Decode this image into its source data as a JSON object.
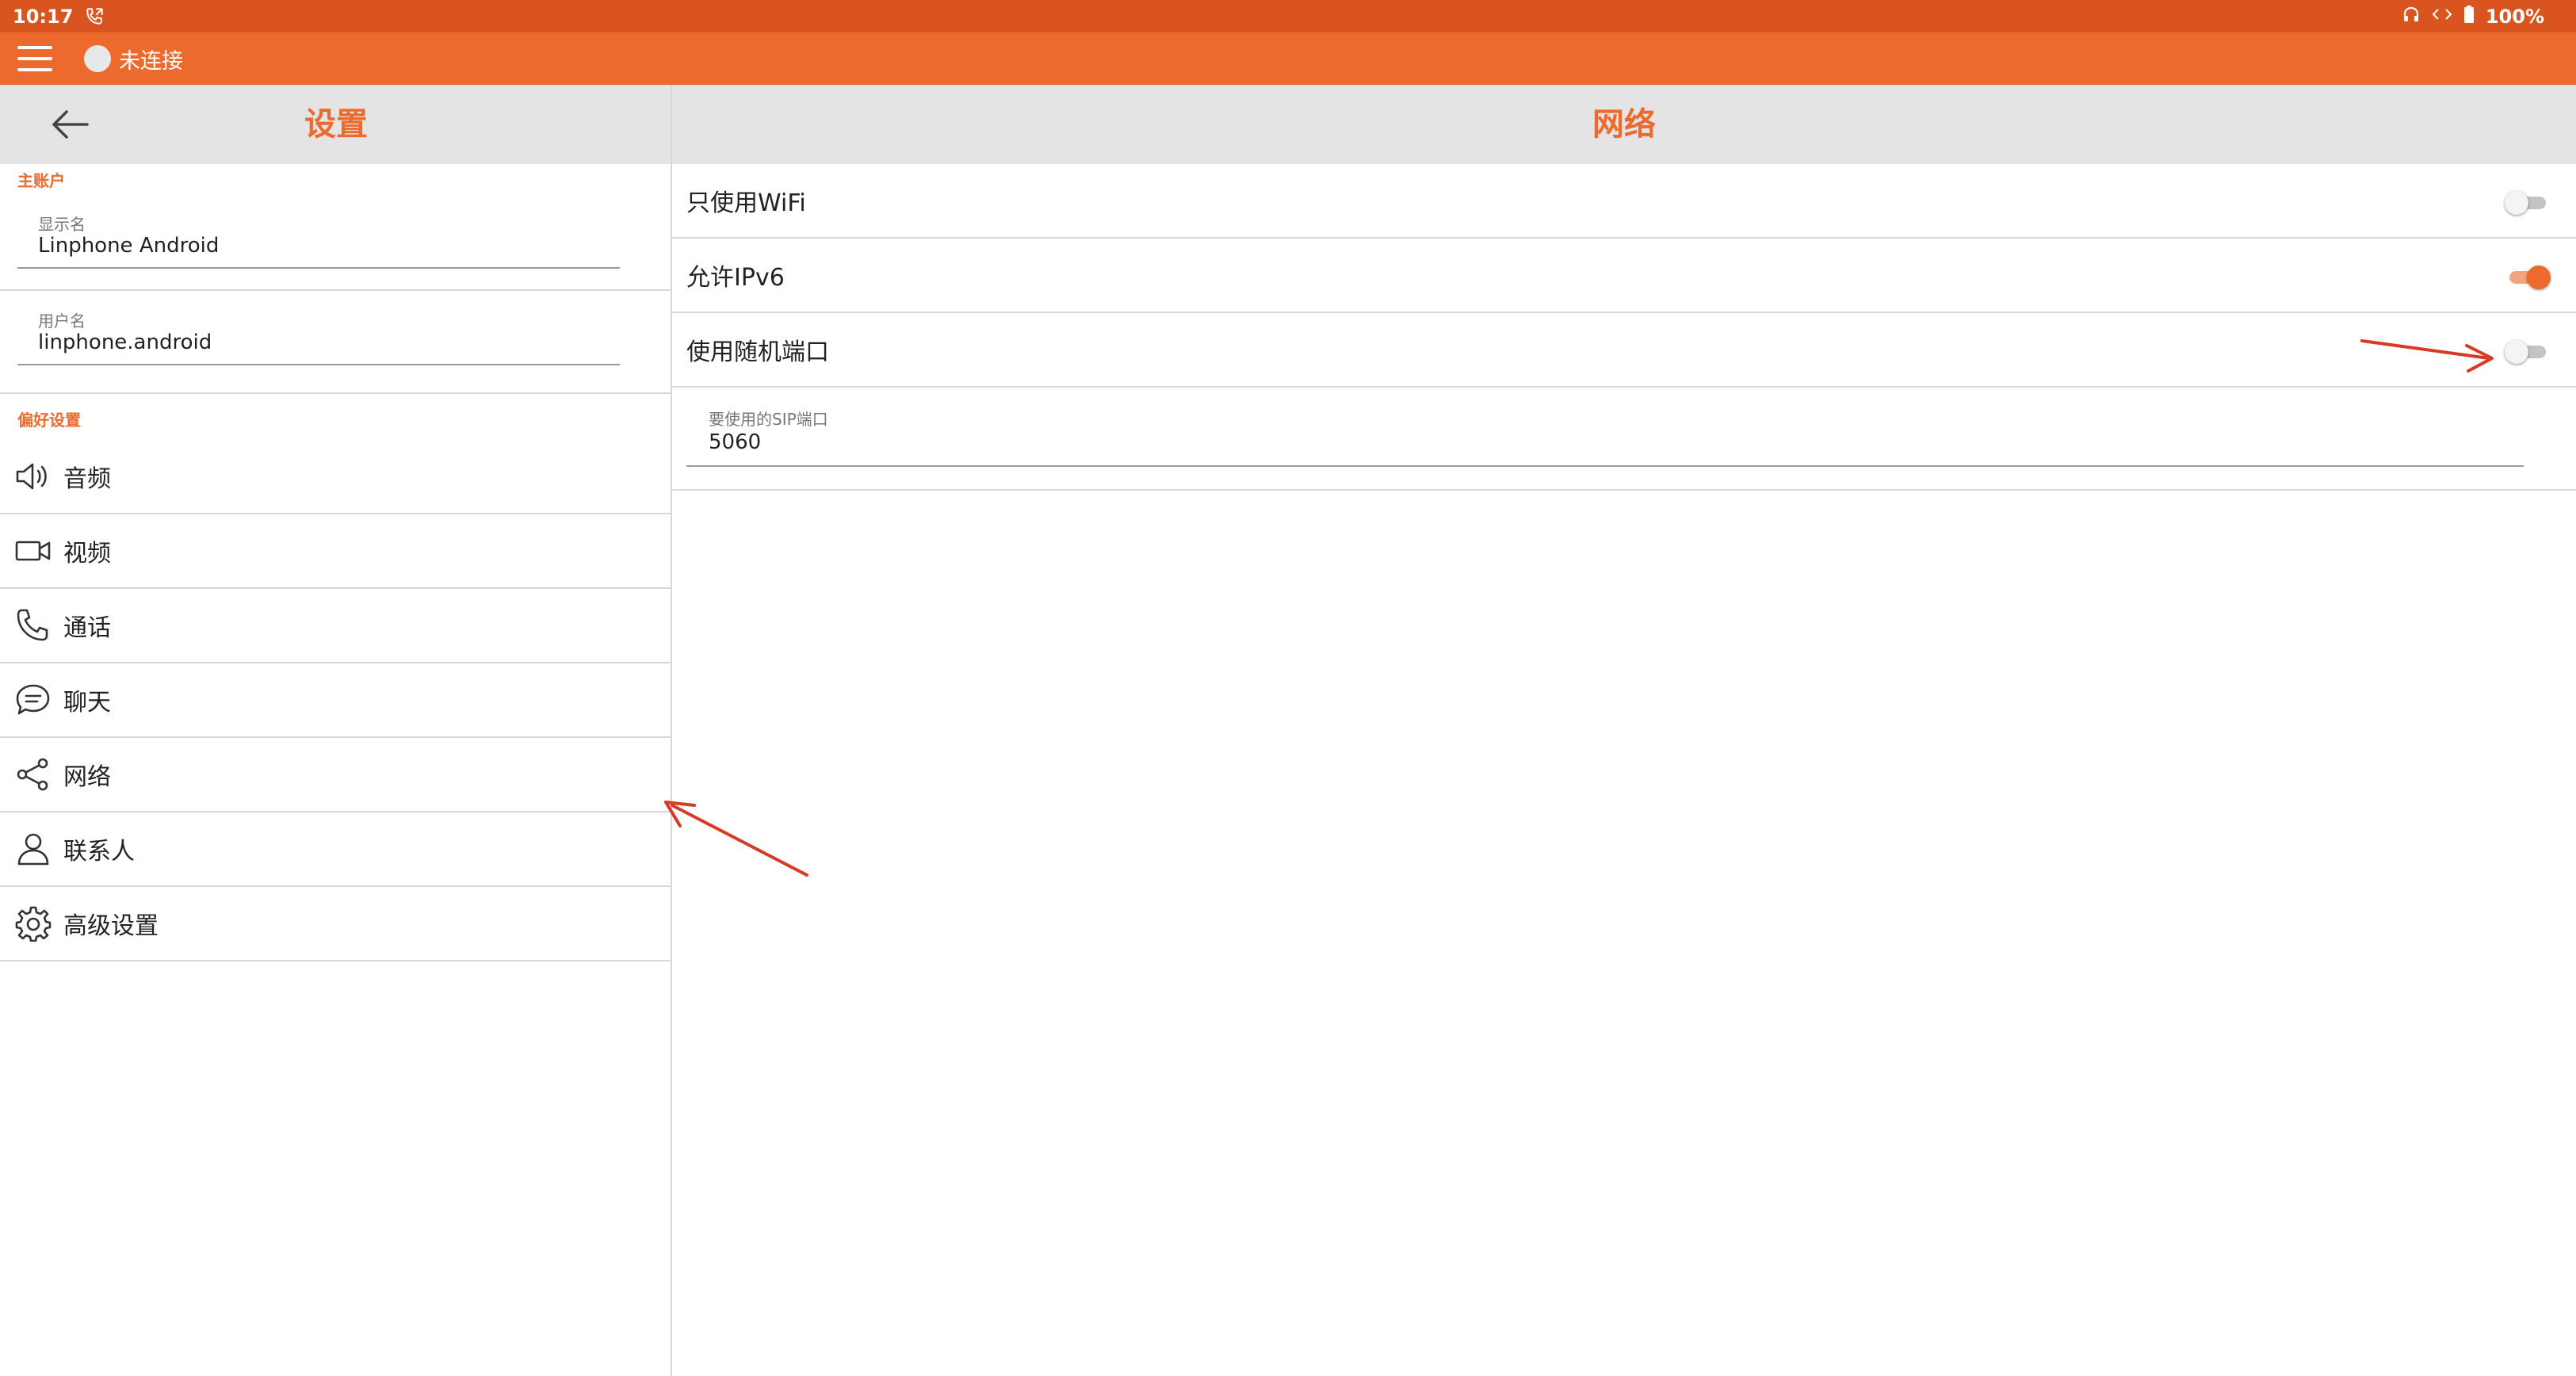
{
  "status_bar": {
    "time": "10:17",
    "left_icon": "phone-call-icon",
    "right_icons": [
      "headphones-icon",
      "data-transfer-icon",
      "battery-icon"
    ],
    "battery": "100%"
  },
  "top_bar": {
    "menu_icon": "hamburger-menu-icon",
    "connection_status": "未连接",
    "accent_color": "#ec6a2d"
  },
  "left_panel": {
    "title": "设置",
    "back_icon": "arrow-left-icon",
    "account_section": {
      "heading": "主账户",
      "display_name_label": "显示名",
      "display_name_value": "Linphone Android",
      "username_label": "用户名",
      "username_value": "linphone.android"
    },
    "preferences_heading": "偏好设置",
    "nav_items": [
      {
        "label": "音频",
        "icon": "speaker-icon"
      },
      {
        "label": "视频",
        "icon": "video-camera-icon"
      },
      {
        "label": "通话",
        "icon": "phone-icon"
      },
      {
        "label": "聊天",
        "icon": "chat-bubble-icon"
      },
      {
        "label": "网络",
        "icon": "share-network-icon"
      },
      {
        "label": "联系人",
        "icon": "person-icon"
      },
      {
        "label": "高级设置",
        "icon": "gear-icon"
      }
    ]
  },
  "right_panel": {
    "title": "网络",
    "settings": [
      {
        "label": "只使用WiFi",
        "enabled": false
      },
      {
        "label": "允许IPv6",
        "enabled": true
      },
      {
        "label": "使用随机端口",
        "enabled": false
      }
    ],
    "sip_port_label": "要使用的SIP端口",
    "sip_port_value": "5060"
  },
  "annotations": {
    "arrow_color": "#d93a26"
  }
}
